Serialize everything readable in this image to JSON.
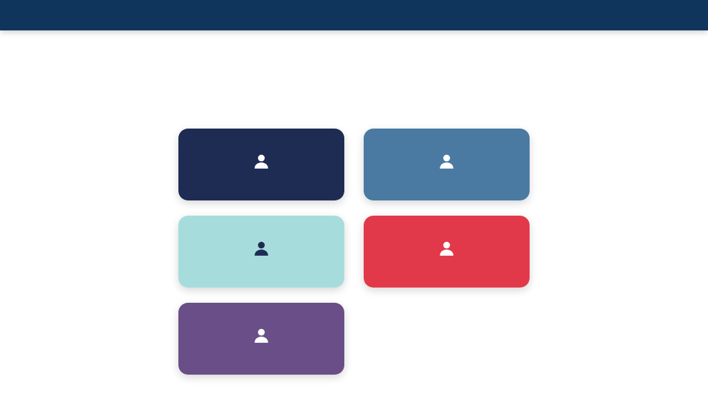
{
  "header": {
    "brand": "",
    "nav": [
      "",
      ""
    ]
  },
  "page": {
    "title": "",
    "subtitle": ""
  },
  "tiles": [
    {
      "label": "",
      "icon": "person-icon",
      "color": "#1e2c53"
    },
    {
      "label": "",
      "icon": "person-icon",
      "color": "#4a7aa1"
    },
    {
      "label": "",
      "icon": "person-icon",
      "color": "#a7dcdc"
    },
    {
      "label": "",
      "icon": "person-icon",
      "color": "#e2394a"
    },
    {
      "label": "",
      "icon": "person-icon",
      "color": "#6a4e87"
    }
  ],
  "colors": {
    "header_bg": "#0f355c",
    "title": "#1e2c4f"
  }
}
